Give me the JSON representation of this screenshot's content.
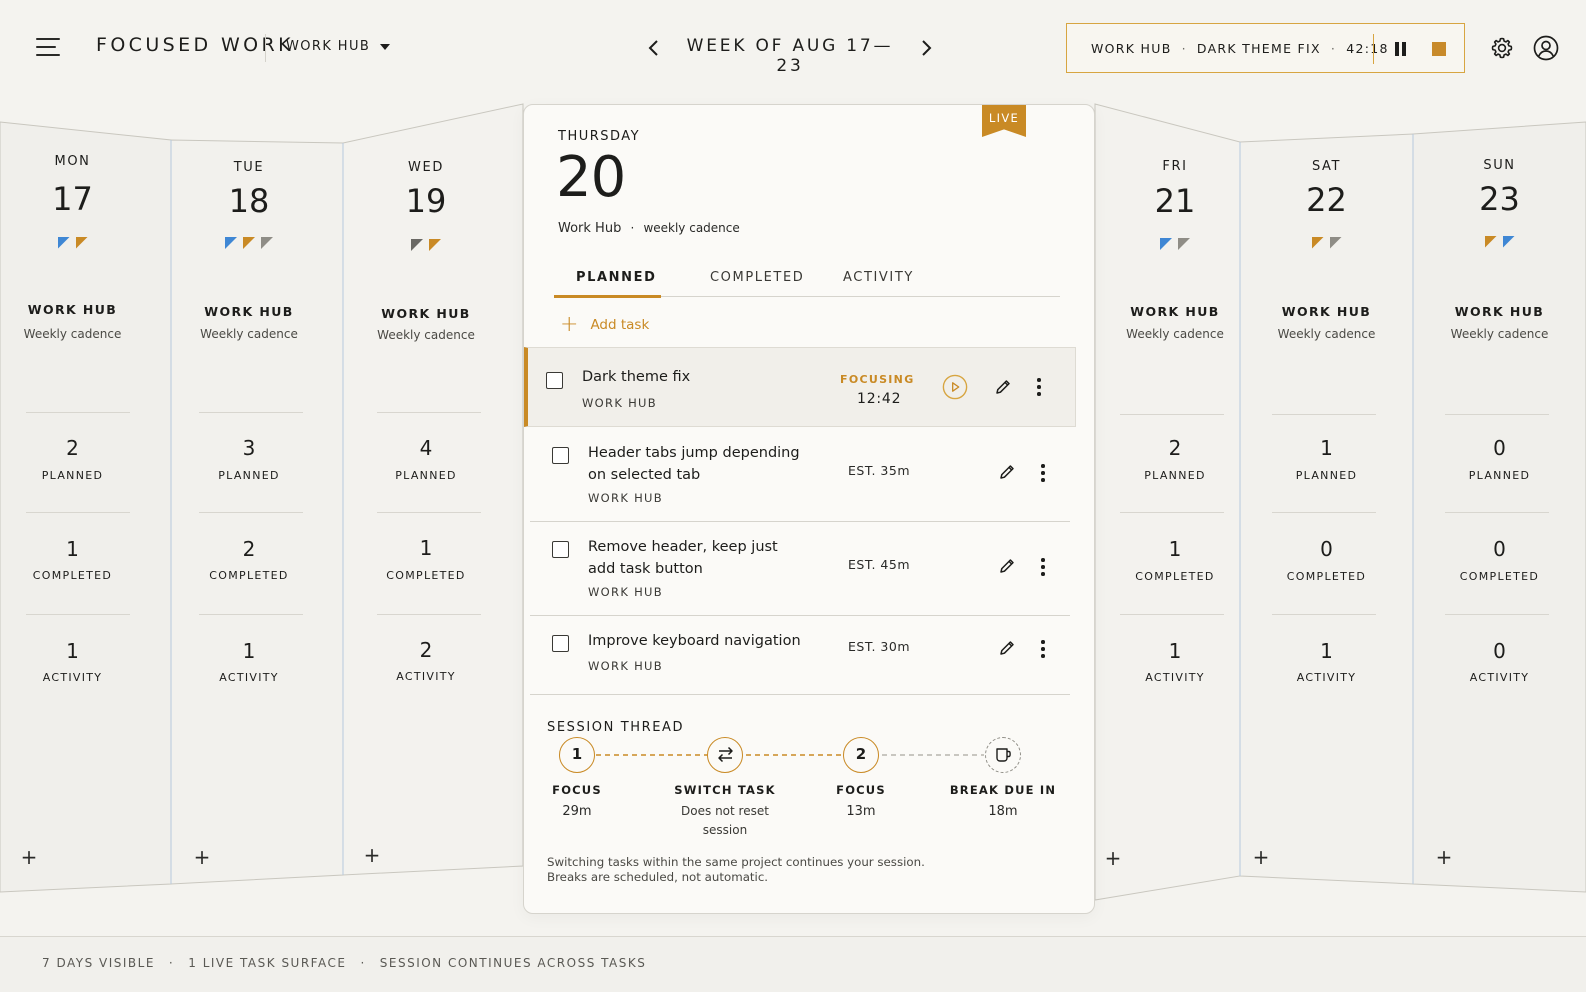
{
  "header": {
    "brand": "FOCUSED WORK",
    "project_select": "WORK HUB",
    "week_title": "WEEK OF AUG 17—23",
    "session": {
      "project": "WORK HUB",
      "task": "DARK THEME FIX",
      "elapsed": "42:18",
      "dot": "·"
    }
  },
  "days": [
    {
      "name": "MON",
      "num": "17",
      "flags": [
        "#3f87d4",
        "#c98a25"
      ],
      "project": "WORK HUB",
      "cadence": "Weekly cadence",
      "planned": "2",
      "completed": "1",
      "activity": "1"
    },
    {
      "name": "TUE",
      "num": "18",
      "flags": [
        "#3f87d4",
        "#c98a25",
        "#8f8d86"
      ],
      "project": "WORK HUB",
      "cadence": "Weekly cadence",
      "planned": "3",
      "completed": "2",
      "activity": "1"
    },
    {
      "name": "WED",
      "num": "19",
      "flags": [
        "#6a6964",
        "#c98a25"
      ],
      "project": "WORK HUB",
      "cadence": "Weekly cadence",
      "planned": "4",
      "completed": "1",
      "activity": "2"
    },
    {
      "name": "FRI",
      "num": "21",
      "flags": [
        "#3f87d4",
        "#8f8d86"
      ],
      "project": "WORK HUB",
      "cadence": "Weekly cadence",
      "planned": "2",
      "completed": "1",
      "activity": "1"
    },
    {
      "name": "SAT",
      "num": "22",
      "flags": [
        "#c98a25",
        "#8f8d86"
      ],
      "project": "WORK HUB",
      "cadence": "Weekly cadence",
      "planned": "1",
      "completed": "0",
      "activity": "1"
    },
    {
      "name": "SUN",
      "num": "23",
      "flags": [
        "#c98a25",
        "#3f87d4"
      ],
      "project": "WORK HUB",
      "cadence": "Weekly cadence",
      "planned": "0",
      "completed": "0",
      "activity": "0"
    }
  ],
  "stat_labels": {
    "planned": "PLANNED",
    "completed": "COMPLETED",
    "activity": "ACTIVITY"
  },
  "today": {
    "live": "LIVE",
    "day_name": "THURSDAY",
    "day_num": "20",
    "project": "Work Hub",
    "dot": "·",
    "cadence": "weekly cadence",
    "tabs": [
      "PLANNED",
      "COMPLETED",
      "ACTIVITY"
    ],
    "add_task": "Add task",
    "tasks": [
      {
        "title": "Dark theme fix",
        "project": "WORK HUB",
        "status": "FOCUSING",
        "time": "12:42"
      },
      {
        "title": "Header tabs jump depending",
        "title2": "on selected tab",
        "project": "WORK HUB",
        "est": "EST. 35m"
      },
      {
        "title": "Remove header, keep just",
        "title2": "add task button",
        "project": "WORK HUB",
        "est": "EST. 45m"
      },
      {
        "title": "Improve keyboard navigation",
        "project": "WORK HUB",
        "est": "EST. 30m"
      }
    ],
    "thread": {
      "title": "SESSION THREAD",
      "nodes": [
        {
          "glyph": "1",
          "label": "FOCUS",
          "sub": "29m"
        },
        {
          "label": "SWITCH TASK",
          "sub": "Does not reset",
          "sub2": "session"
        },
        {
          "glyph": "2",
          "label": "FOCUS",
          "sub": "13m"
        },
        {
          "label": "BREAK DUE IN",
          "sub": "18m"
        }
      ]
    },
    "note_line1": "Switching tasks within the same project continues your session.",
    "note_line2": "Breaks are scheduled, not automatic."
  },
  "footer": {
    "items": [
      "7 DAYS VISIBLE",
      "1 LIVE TASK SURFACE",
      "SESSION CONTINUES ACROSS TASKS"
    ],
    "dot": "·"
  }
}
